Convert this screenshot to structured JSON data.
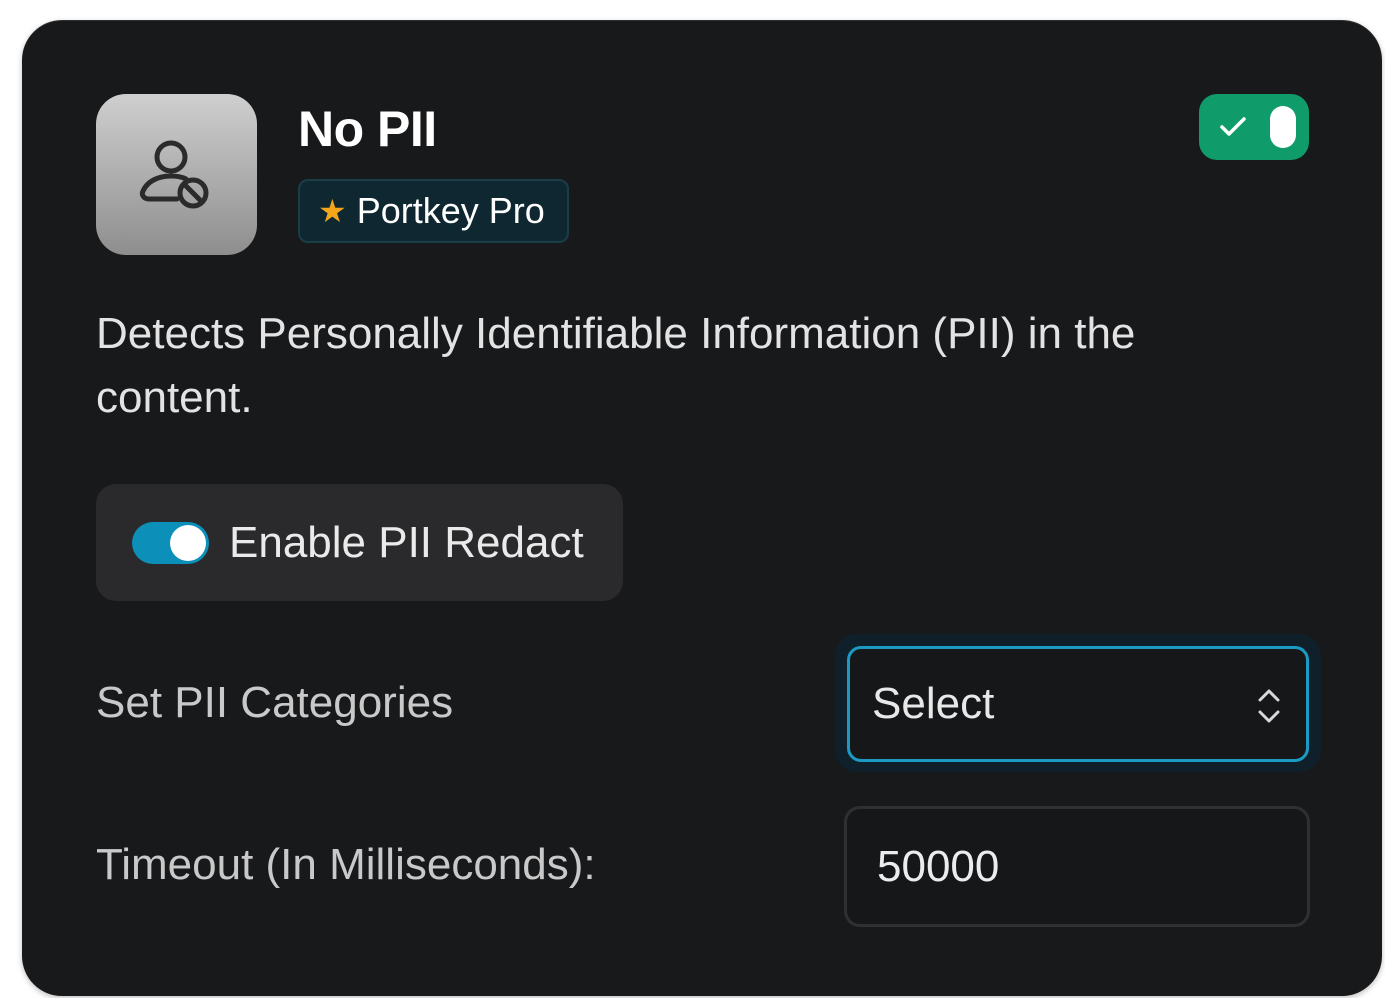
{
  "card": {
    "title": "No PII",
    "badge": {
      "icon": "star-icon",
      "label": "Portkey Pro"
    },
    "app_icon": "user-blocked-icon",
    "enabled": true,
    "description": "Detects Personally Identifiable Information (PII) in the content."
  },
  "redact": {
    "label": "Enable PII Redact",
    "on": true
  },
  "fields": {
    "categories": {
      "label": "Set PII Categories",
      "value": "Select"
    },
    "timeout": {
      "label": "Timeout (In Milliseconds):",
      "value": "50000"
    }
  },
  "colors": {
    "card_bg": "#18191b",
    "enabled_toggle": "#0f9b6a",
    "switch_on": "#0c8fb8",
    "focus_border": "#1b9bc3",
    "star": "#f4a51c"
  }
}
